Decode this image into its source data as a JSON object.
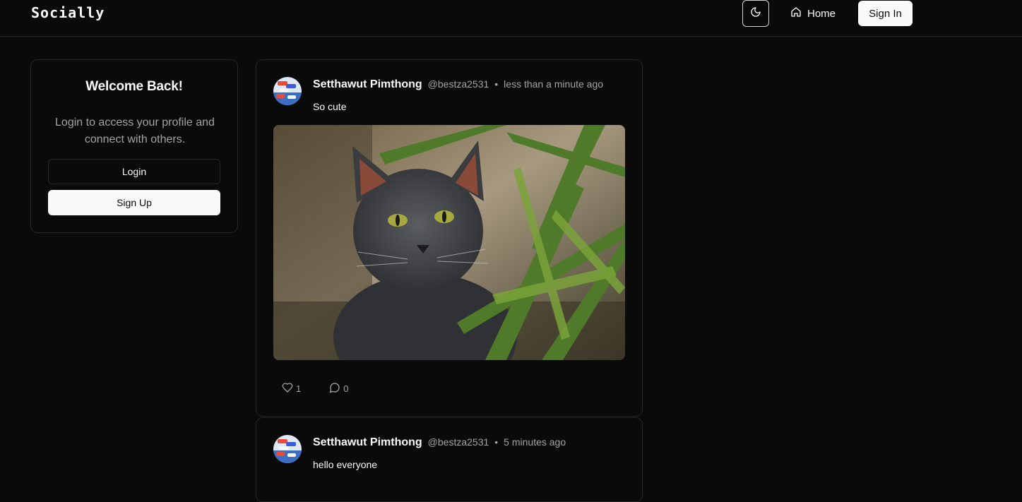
{
  "nav": {
    "logo": "Socially",
    "home_label": "Home",
    "signin_label": "Sign In"
  },
  "welcome": {
    "title": "Welcome Back!",
    "description": "Login to access your profile and connect with others.",
    "login_label": "Login",
    "signup_label": "Sign Up"
  },
  "posts": [
    {
      "author": "Setthawut Pimthong",
      "handle": "@bestza2531",
      "separator": "•",
      "time": "less than a minute ago",
      "text": "So cute",
      "likes": "1",
      "comments": "0"
    },
    {
      "author": "Setthawut Pimthong",
      "handle": "@bestza2531",
      "separator": "•",
      "time": "5 minutes ago",
      "text": "hello everyone"
    }
  ],
  "icons": {
    "theme": "moon-icon",
    "home": "home-icon",
    "like": "heart-icon",
    "comment": "comment-icon"
  },
  "colors": {
    "background": "#0a0a0a",
    "border": "#262626",
    "text": "#fafafa",
    "muted": "#a3a3a3"
  }
}
